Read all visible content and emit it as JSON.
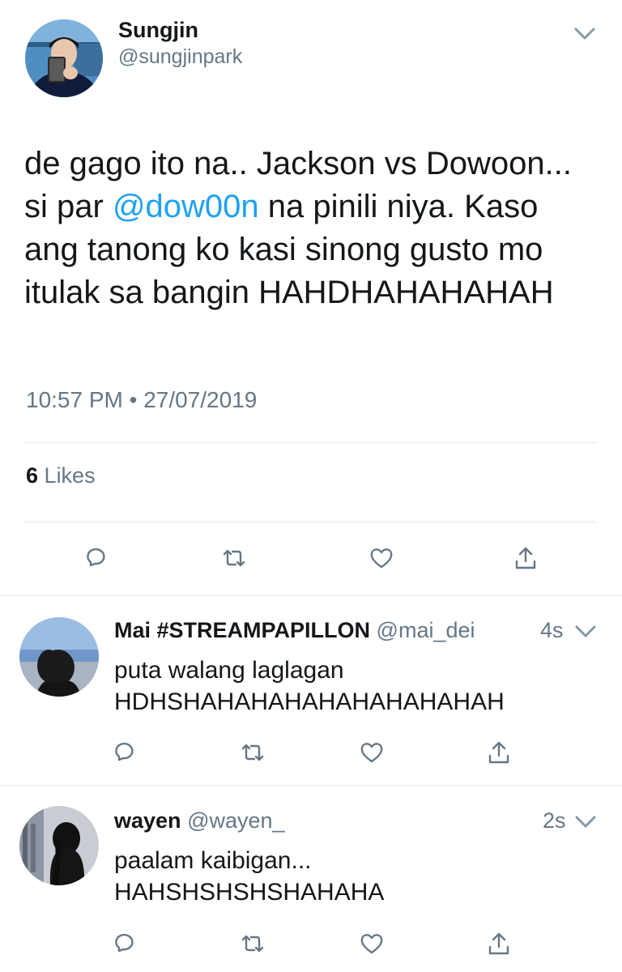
{
  "main_tweet": {
    "display_name": "Sungjin",
    "handle": "@sungjinpark",
    "text_before_mention": "de gago ito na.. Jackson vs Dowoon... si par ",
    "mention": "@dow00n",
    "text_after_mention": " na pinili niya. Kaso ang tanong ko kasi sinong gusto mo itulak sa bangin HAHDHAHAHAHAH",
    "timestamp": "10:57 PM • 27/07/2019",
    "likes_count": "6",
    "likes_label": "Likes"
  },
  "replies": [
    {
      "display_name": "Mai #STREAMPAPILLON",
      "handle": "@mai_dei",
      "time": "4s",
      "line1": "puta walang laglagan",
      "line2": "HDHSHAHAHAHAHAHAHAHAHAH"
    },
    {
      "display_name": "wayen",
      "handle": "@wayen_",
      "time": "2s",
      "line1": "paalam kaibigan...",
      "line2": "HAHSHSHSHSHAHAHA"
    }
  ],
  "icons": [
    "reply-icon",
    "retweet-icon",
    "like-icon",
    "share-icon",
    "chevron-down-icon"
  ],
  "colors": {
    "link": "#1da1f2",
    "secondary_text": "#657786",
    "divider": "#e1e8ed",
    "icon": "#657786"
  }
}
